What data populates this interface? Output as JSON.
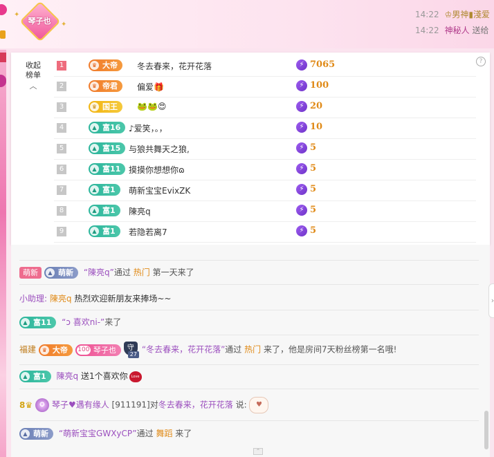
{
  "header": {
    "anchor_badge": "琴子也",
    "messages": [
      {
        "time": "14:22",
        "user": "男神",
        "user2": "淺爱"
      },
      {
        "time": "14:22",
        "user": "神秘人",
        "text": "送给"
      }
    ]
  },
  "rank_panel": {
    "collapse_label_1": "收起",
    "collapse_label_2": "榜单",
    "help": "?",
    "rows": [
      {
        "rank": "1",
        "level": "大帝",
        "level_color": "orange",
        "name": "冬去春来，花开花落",
        "value": "7065"
      },
      {
        "rank": "2",
        "level": "帝君",
        "level_color": "orange",
        "name": "偏爱🎁",
        "value": "100"
      },
      {
        "rank": "3",
        "level": "国王",
        "level_color": "yellow",
        "name": "🐸🐸😍",
        "value": "20"
      },
      {
        "rank": "4",
        "level": "富16",
        "level_color": "green",
        "name": "♪爱笑，。，",
        "value": "10"
      },
      {
        "rank": "5",
        "level": "富15",
        "level_color": "green",
        "name": "与狼共舞天之狼,",
        "value": "5"
      },
      {
        "rank": "6",
        "level": "富11",
        "level_color": "green",
        "name": "摸摸你想想你ɷ",
        "value": "5"
      },
      {
        "rank": "7",
        "level": "富1",
        "level_color": "green",
        "name": "萌新宝宝EvixZK",
        "value": "5"
      },
      {
        "rank": "8",
        "level": "富1",
        "level_color": "green",
        "name": "陳亮q",
        "value": "5"
      },
      {
        "rank": "9",
        "level": "富1",
        "level_color": "green",
        "name": "若隐若离7",
        "value": "5"
      }
    ]
  },
  "chat": {
    "line1": {
      "tag": "萌新",
      "level": "萌新",
      "quote_open": "“",
      "user": "陳亮q",
      "quote_close": "”",
      "via": "通过",
      "source": "热门",
      "text": "第一天来了"
    },
    "line2": {
      "prefix": "小助理:",
      "user": "陳亮q",
      "text": "热烈欢迎新朋友来捧场~~"
    },
    "line3": {
      "level": "富11",
      "quote_open": "“",
      "user": "ↄ 喜欢ni-",
      "quote_close": "”",
      "text": "来了"
    },
    "line4": {
      "city": "福建",
      "level": "大帝",
      "fan_level": "100",
      "fan_name": "琴子也",
      "guard_char": "守",
      "guard_num": "27",
      "quote_open": "“",
      "user": "冬去春来，花开花落",
      "quote_close": "”",
      "via": "通过",
      "source": "热门",
      "text": "来了，他是房间7天粉丝榜第一名哦!"
    },
    "line5": {
      "level": "富1",
      "user": "陳亮q",
      "text": "送1个喜欢你",
      "gift_label": "Love"
    },
    "line6": {
      "num": "8",
      "user": "琴子♥遇有缘人",
      "room": "[911191]",
      "to": "对",
      "target": "冬去春来，花开花落",
      "say": "说:"
    },
    "line7": {
      "level": "萌新",
      "quote_open": "“",
      "user": "萌新宝宝GWXyCP",
      "quote_close": "”",
      "via": "通过",
      "source": "舞蹈",
      "text": "来了"
    }
  }
}
